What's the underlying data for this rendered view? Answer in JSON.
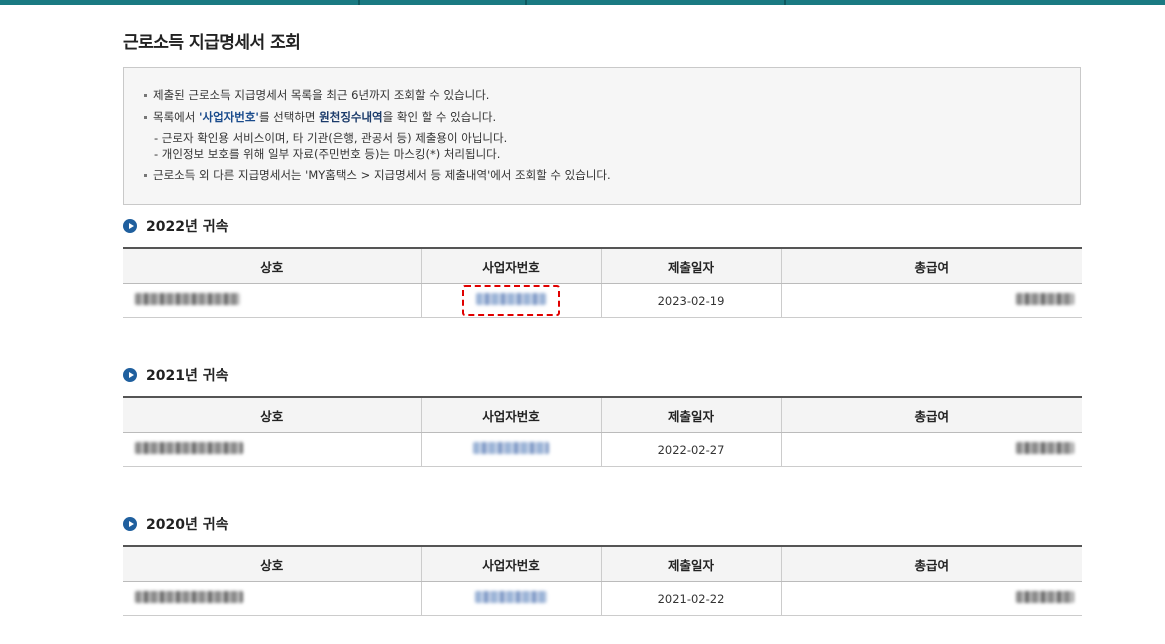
{
  "page": {
    "title": "근로소득 지급명세서 조회"
  },
  "info": {
    "line1": "제출된 근로소득 지급명세서 목록을 최근 6년까지 조회할 수 있습니다.",
    "line2_pre": "목록에서 ",
    "line2_hl1": "'사업자번호'",
    "line2_mid": "를 선택하면 ",
    "line2_hl2": "원천징수내역",
    "line2_post": "을 확인 할 수 있습니다.",
    "line3": "- 근로자 확인용 서비스이며, 타 기관(은행, 관공서 등) 제출용이 아닙니다.",
    "line4": "- 개인정보 보호를 위해 일부 자료(주민번호 등)는 마스킹(*) 처리됩니다.",
    "line5": "근로소득 외 다른 지급명세서는 'MY홈택스 > 지급명세서 등 제출내역'에서 조회할 수 있습니다."
  },
  "columns": [
    "상호",
    "사업자번호",
    "제출일자",
    "총급여"
  ],
  "sections": [
    {
      "title": "2022년 귀속",
      "row": {
        "date": "2023-02-19"
      }
    },
    {
      "title": "2021년 귀속",
      "row": {
        "date": "2022-02-27"
      }
    },
    {
      "title": "2020년 귀속",
      "row": {
        "date": "2021-02-22"
      }
    }
  ]
}
